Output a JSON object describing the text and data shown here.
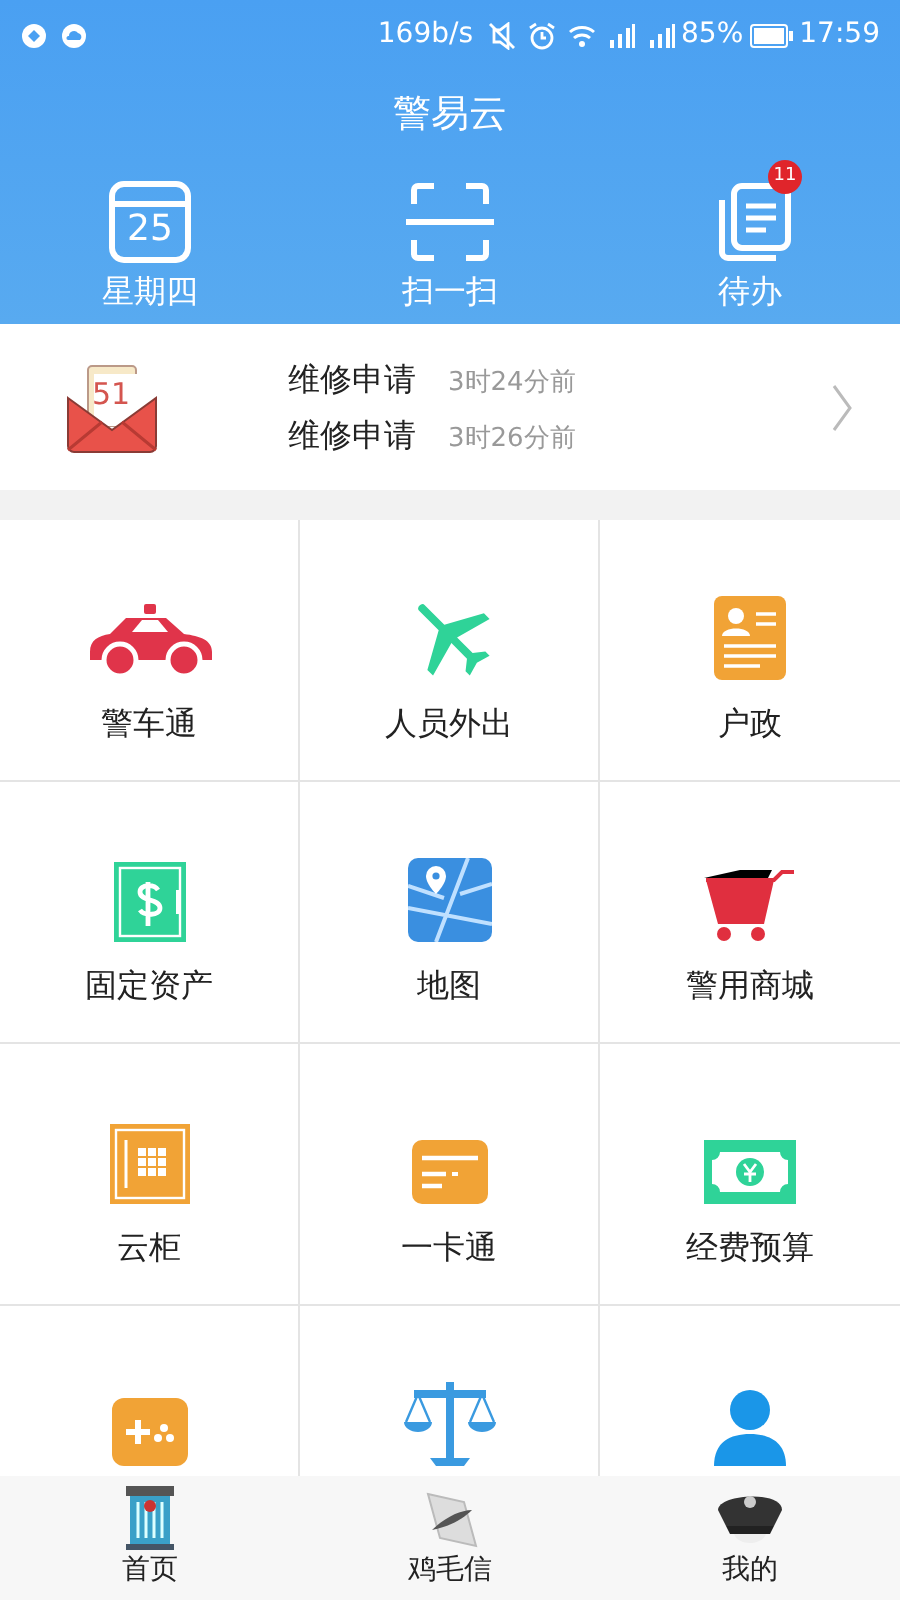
{
  "status_bar": {
    "speed": "169b/s",
    "battery": "85%",
    "time": "17:59"
  },
  "header": {
    "title": "警易云"
  },
  "quick_actions": [
    {
      "label": "星期四",
      "date": "25"
    },
    {
      "label": "扫一扫"
    },
    {
      "label": "待办",
      "badge": "11"
    }
  ],
  "notifications": {
    "icon_number": "51",
    "items": [
      {
        "title": "维修申请",
        "time": "3时24分前"
      },
      {
        "title": "维修申请",
        "time": "3时26分前"
      }
    ]
  },
  "apps": [
    {
      "kind": "labeled",
      "label": "警车通"
    },
    {
      "kind": "labeled",
      "label": "人员外出"
    },
    {
      "kind": "labeled",
      "label": "户政"
    },
    {
      "kind": "labeled",
      "label": "固定资产"
    },
    {
      "kind": "labeled",
      "label": "地图"
    },
    {
      "kind": "labeled",
      "label": "警用商城"
    },
    {
      "kind": "labeled",
      "label": "云柜"
    },
    {
      "kind": "labeled",
      "label": "一卡通"
    },
    {
      "kind": "labeled",
      "label": "经费预算"
    },
    {
      "kind": "icon_only"
    },
    {
      "kind": "icon_only"
    },
    {
      "kind": "icon_only"
    }
  ],
  "bottom_nav": [
    {
      "label": "首页"
    },
    {
      "label": "鸡毛信"
    },
    {
      "label": "我的"
    }
  ]
}
